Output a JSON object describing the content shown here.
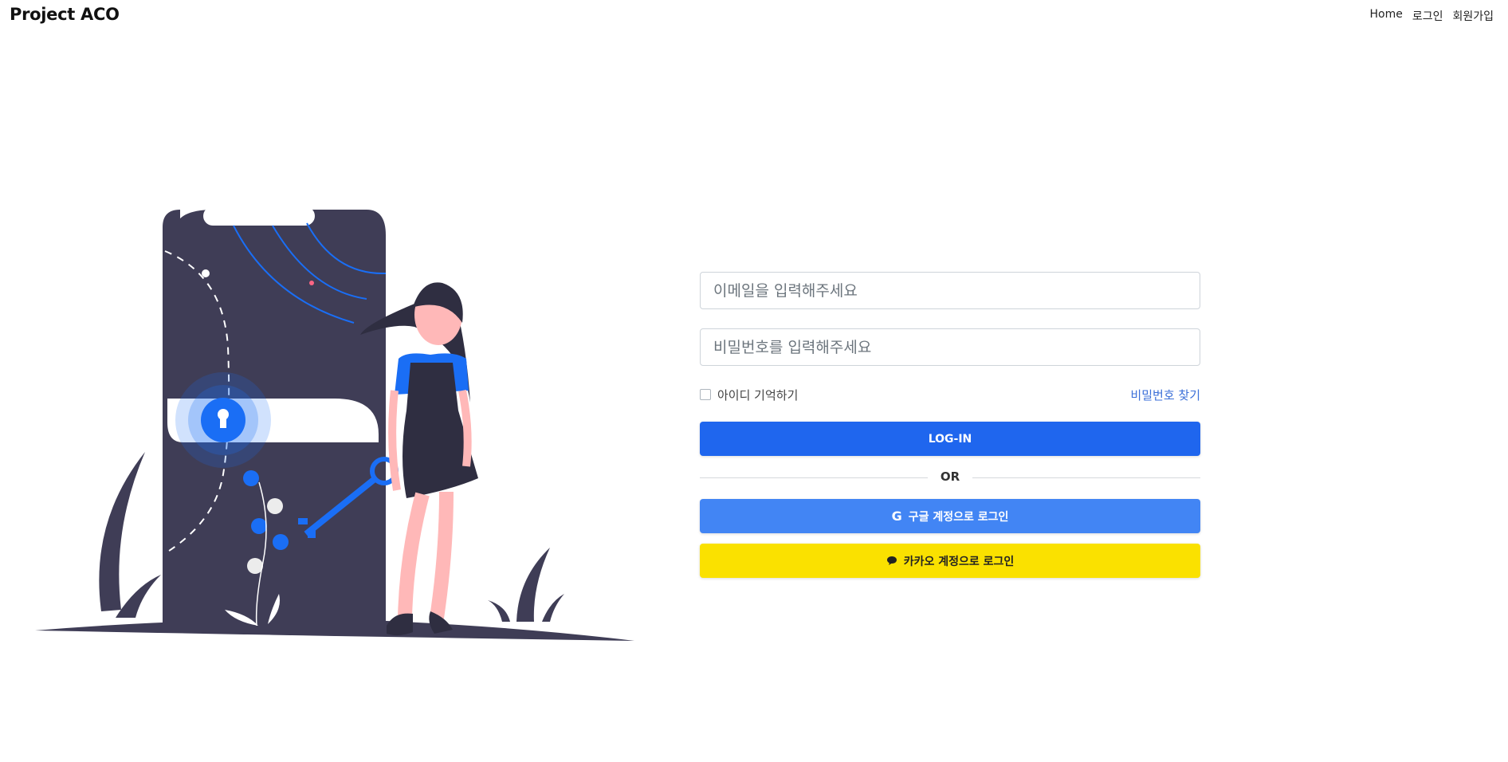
{
  "header": {
    "brand": "Project ACO",
    "nav": [
      "Home",
      "로그인",
      "회원가입"
    ]
  },
  "login_form": {
    "email_placeholder": "이메일을 입력해주세요",
    "password_placeholder": "비밀번호를 입력해주세요",
    "remember_label": "아이디 기억하기",
    "find_password": "비밀번호 찾기",
    "login_button": "LOG-IN",
    "divider": "OR",
    "google_button": "구글 계정으로 로그인",
    "kakao_button": "카카오 계정으로 로그인"
  },
  "colors": {
    "primary": "#1f66ee",
    "google": "#4285f4",
    "kakao": "#fae100",
    "illustration_dark": "#3f3d56",
    "illustration_accent": "#1a6ef5",
    "skin": "#ffb8b8"
  },
  "icons": [
    "keyhole-icon",
    "key-icon",
    "google-g-icon",
    "chat-bubble-icon"
  ]
}
